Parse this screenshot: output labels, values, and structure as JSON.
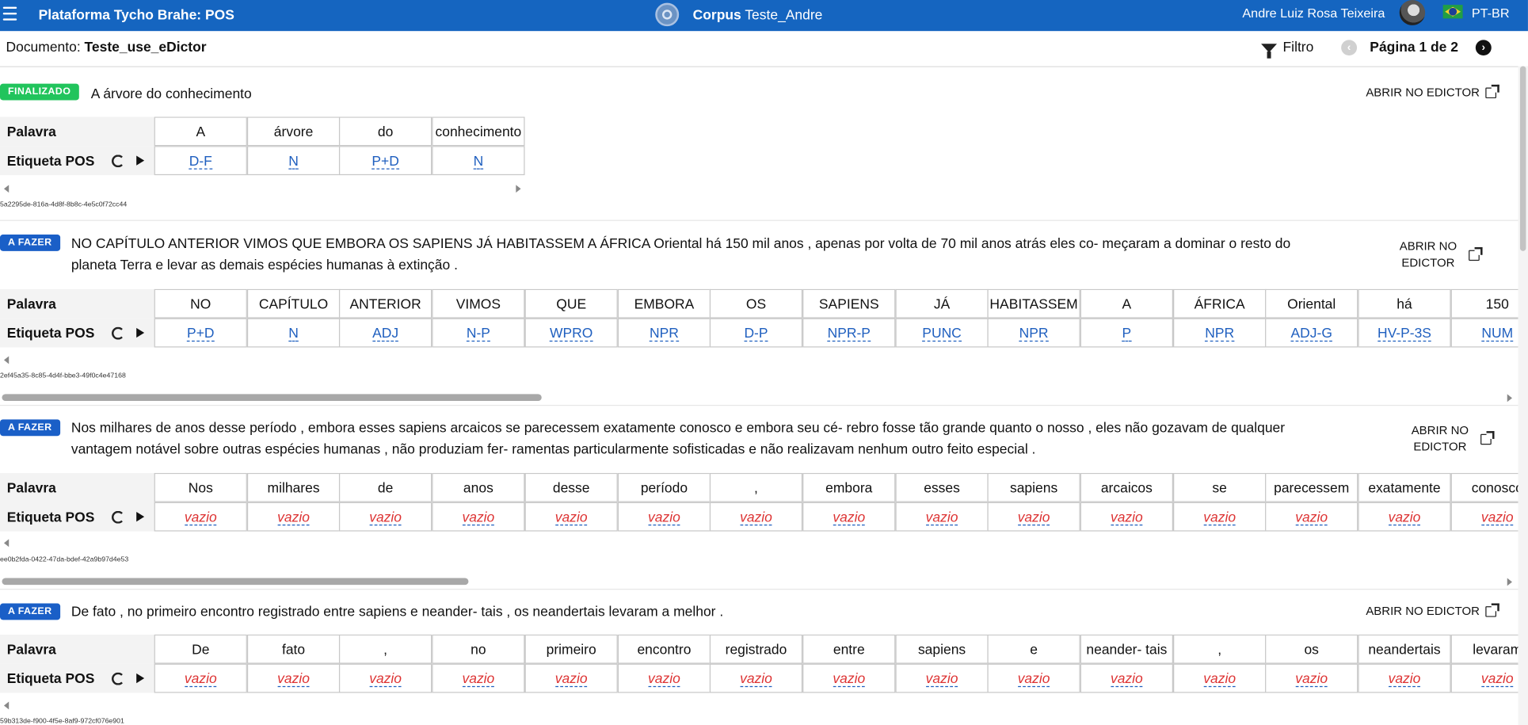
{
  "header": {
    "app_title": "Plataforma Tycho Brahe: POS",
    "corpus_bold": "Corpus",
    "corpus_name": "Teste_Andre",
    "user_name": "Andre Luiz Rosa Teixeira",
    "language": "PT-BR",
    "colors": {
      "bar": "#1565c0"
    }
  },
  "docbar": {
    "document_label": "Documento:",
    "document_name": "Teste_use_eDictor",
    "filter_label": "Filtro",
    "page_label": "Página 1 de 2"
  },
  "row_labels": {
    "word": "Palavra",
    "tag": "Etiqueta POS"
  },
  "open_editor_label": "ABRIR NO EDICTOR",
  "open_editor_line1": "ABRIR NO",
  "open_editor_line2": "EDICTOR",
  "sentences": [
    {
      "status": "FINALIZADO",
      "text": "A árvore do conhecimento",
      "words": [
        "A",
        "árvore",
        "do",
        "conhecimento"
      ],
      "tags": [
        "D-F",
        "N",
        "P+D",
        "N"
      ],
      "id": "5a2295de-816a-4d8f-8b8c-4e5c0f72cc44"
    },
    {
      "status": "A FAZER",
      "text_line1": "NO CAPÍTULO ANTERIOR VIMOS QUE EMBORA OS SAPIENS JÁ HABITASSEM A ÁFRICA Oriental há 150 mil anos , apenas por volta de 70 mil anos atrás eles co- meçaram a dominar o resto do",
      "text_line2": "planeta Terra e levar as demais espécies humanas à extinção .",
      "words": [
        "NO",
        "CAPÍTULO",
        "ANTERIOR",
        "VIMOS",
        "QUE",
        "EMBORA",
        "OS",
        "SAPIENS",
        "JÁ",
        "HABITASSEM",
        "A",
        "ÁFRICA",
        "Oriental",
        "há",
        "150"
      ],
      "tags": [
        "P+D",
        "N",
        "ADJ",
        "N-P",
        "WPRO",
        "NPR",
        "D-P",
        "NPR-P",
        "PUNC",
        "NPR",
        "P",
        "NPR",
        "ADJ-G",
        "HV-P-3S",
        "NUM"
      ],
      "id": "2ef45a35-8c85-4d4f-bbe3-49f0c4e47168"
    },
    {
      "status": "A FAZER",
      "text_line1": "Nos milhares de anos desse período , embora esses sapiens arcaicos se parecessem exatamente conosco e embora seu cé- rebro fosse tão grande quanto o nosso , eles não gozavam de qualquer",
      "text_line2": "vantagem notável sobre outras espécies humanas , não produziam fer- ramentas particularmente sofisticadas e não realizavam nenhum outro feito especial .",
      "words": [
        "Nos",
        "milhares",
        "de",
        "anos",
        "desse",
        "período",
        ",",
        "embora",
        "esses",
        "sapiens",
        "arcaicos",
        "se",
        "parecessem",
        "exatamente",
        "conosco"
      ],
      "tag_value": "vazio",
      "id": "ee0b2fda-0422-47da-bdef-42a9b97d4e53"
    },
    {
      "status": "A FAZER",
      "text": "De fato , no primeiro encontro registrado entre sapiens e neander- tais , os neandertais levaram a melhor .",
      "words": [
        "De",
        "fato",
        ",",
        "no",
        "primeiro",
        "encontro",
        "registrado",
        "entre",
        "sapiens",
        "e",
        "neander- tais",
        ",",
        "os",
        "neandertais",
        "levaram"
      ],
      "tag_value": "vazio",
      "id": "59b313de-f900-4f5e-8af9-972cf076e901"
    }
  ]
}
